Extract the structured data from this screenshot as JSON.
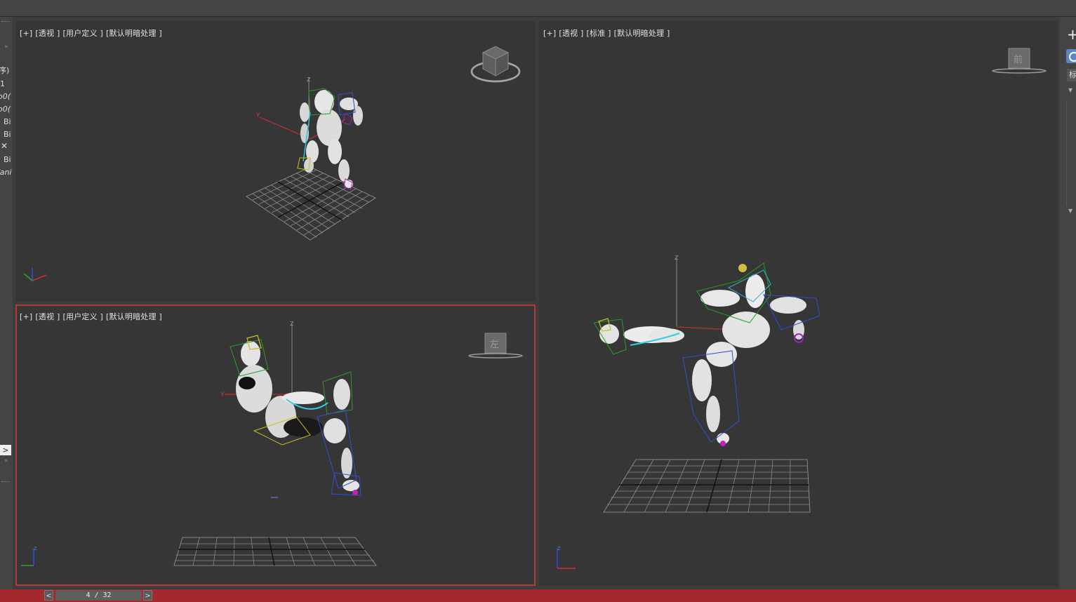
{
  "viewports": {
    "top_left": {
      "labels": [
        "[+]",
        "[透视 ]",
        "[用户定义 ]",
        "[默认明暗处理 ]"
      ]
    },
    "bottom_left": {
      "labels": [
        "[+]",
        "[透视 ]",
        "[用户定义 ]",
        "[默认明暗处理 ]"
      ],
      "viewcube_text": "左"
    },
    "right": {
      "labels": [
        "[+]",
        "[透视 ]",
        "[标准 ]",
        "[默认明暗处理 ]"
      ],
      "viewcube_text": "前"
    }
  },
  "axis_labels": {
    "x": "X",
    "y": "Y",
    "z": "Z"
  },
  "left_panel": {
    "items": [
      "序)",
      "1",
      "o0(",
      "o0(",
      "Bi",
      "Bi",
      "Bi",
      "/ani"
    ]
  },
  "right_panel": {
    "tab_label": "标"
  },
  "pagination": {
    "prev": "<",
    "next": ">",
    "indicator": "4 / 32"
  },
  "left_expand": ">",
  "accent_colors": {
    "active_border": "#b23a3a",
    "status_bar": "#a3292e"
  }
}
